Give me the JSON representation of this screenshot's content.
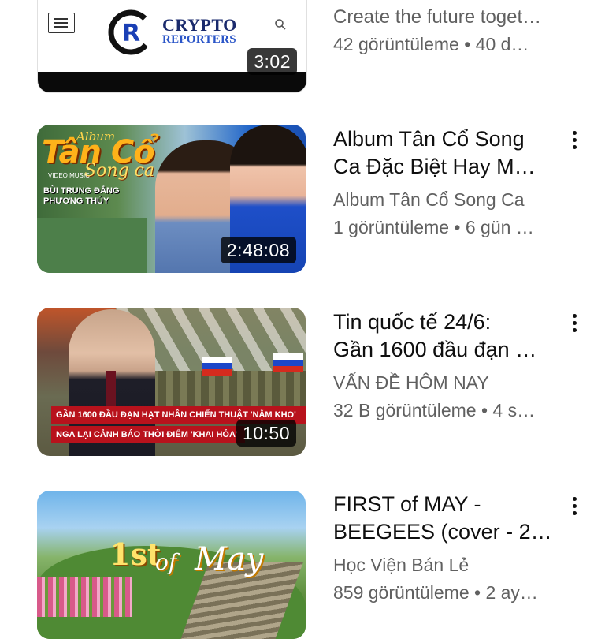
{
  "videos": [
    {
      "title": "Create the future toget…",
      "meta": "42 görüntüleme • 40 d…",
      "duration": "3:02",
      "thumb": {
        "logo_line1": "CRYPTO",
        "logo_line2": "REPORTERS"
      },
      "more_icon": "more-vert-icon"
    },
    {
      "title_line1": "Album Tân Cổ Song",
      "title_line2": "Ca Đặc Biệt Hay M…",
      "channel": "Album Tân Cổ Song Ca",
      "meta": "1 görüntüleme • 6 gün …",
      "duration": "2:48:08",
      "thumb": {
        "album": "Album",
        "big": "Tân Cổ",
        "sub": "Song ca",
        "video_music": "VIDEO MUSIC",
        "singer1": "BÙI TRUNG ĐẲNG",
        "singer2": "PHƯƠNG THỦY"
      }
    },
    {
      "title_line1": "Tin quốc tế 24/6:",
      "title_line2": "Gần 1600 đầu đạn …",
      "channel": "VẤN ĐỀ HÔM NAY",
      "meta": "32 B görüntüleme • 4 s…",
      "duration": "10:50",
      "thumb": {
        "band1": "GẦN 1600 ĐẦU ĐẠN HẠT NHÂN CHIẾN THUẬT 'NẰM KHO'",
        "band2": "NGA LẠI CẢNH BÁO THỜI ĐIỂM 'KHAI HỎA'"
      }
    },
    {
      "title_line1": "FIRST of MAY -",
      "title_line2": "BEEGEES (cover - 2…",
      "channel": "Học Viện Bán Lẻ",
      "meta": "859 görüntüleme • 2 ay…",
      "thumb": {
        "t1": "1st",
        "t2": "of",
        "t3": "May"
      }
    }
  ],
  "colors": {
    "meta_gray": "#606060",
    "title": "#0f0f0f",
    "news_red": "#b8121c"
  }
}
